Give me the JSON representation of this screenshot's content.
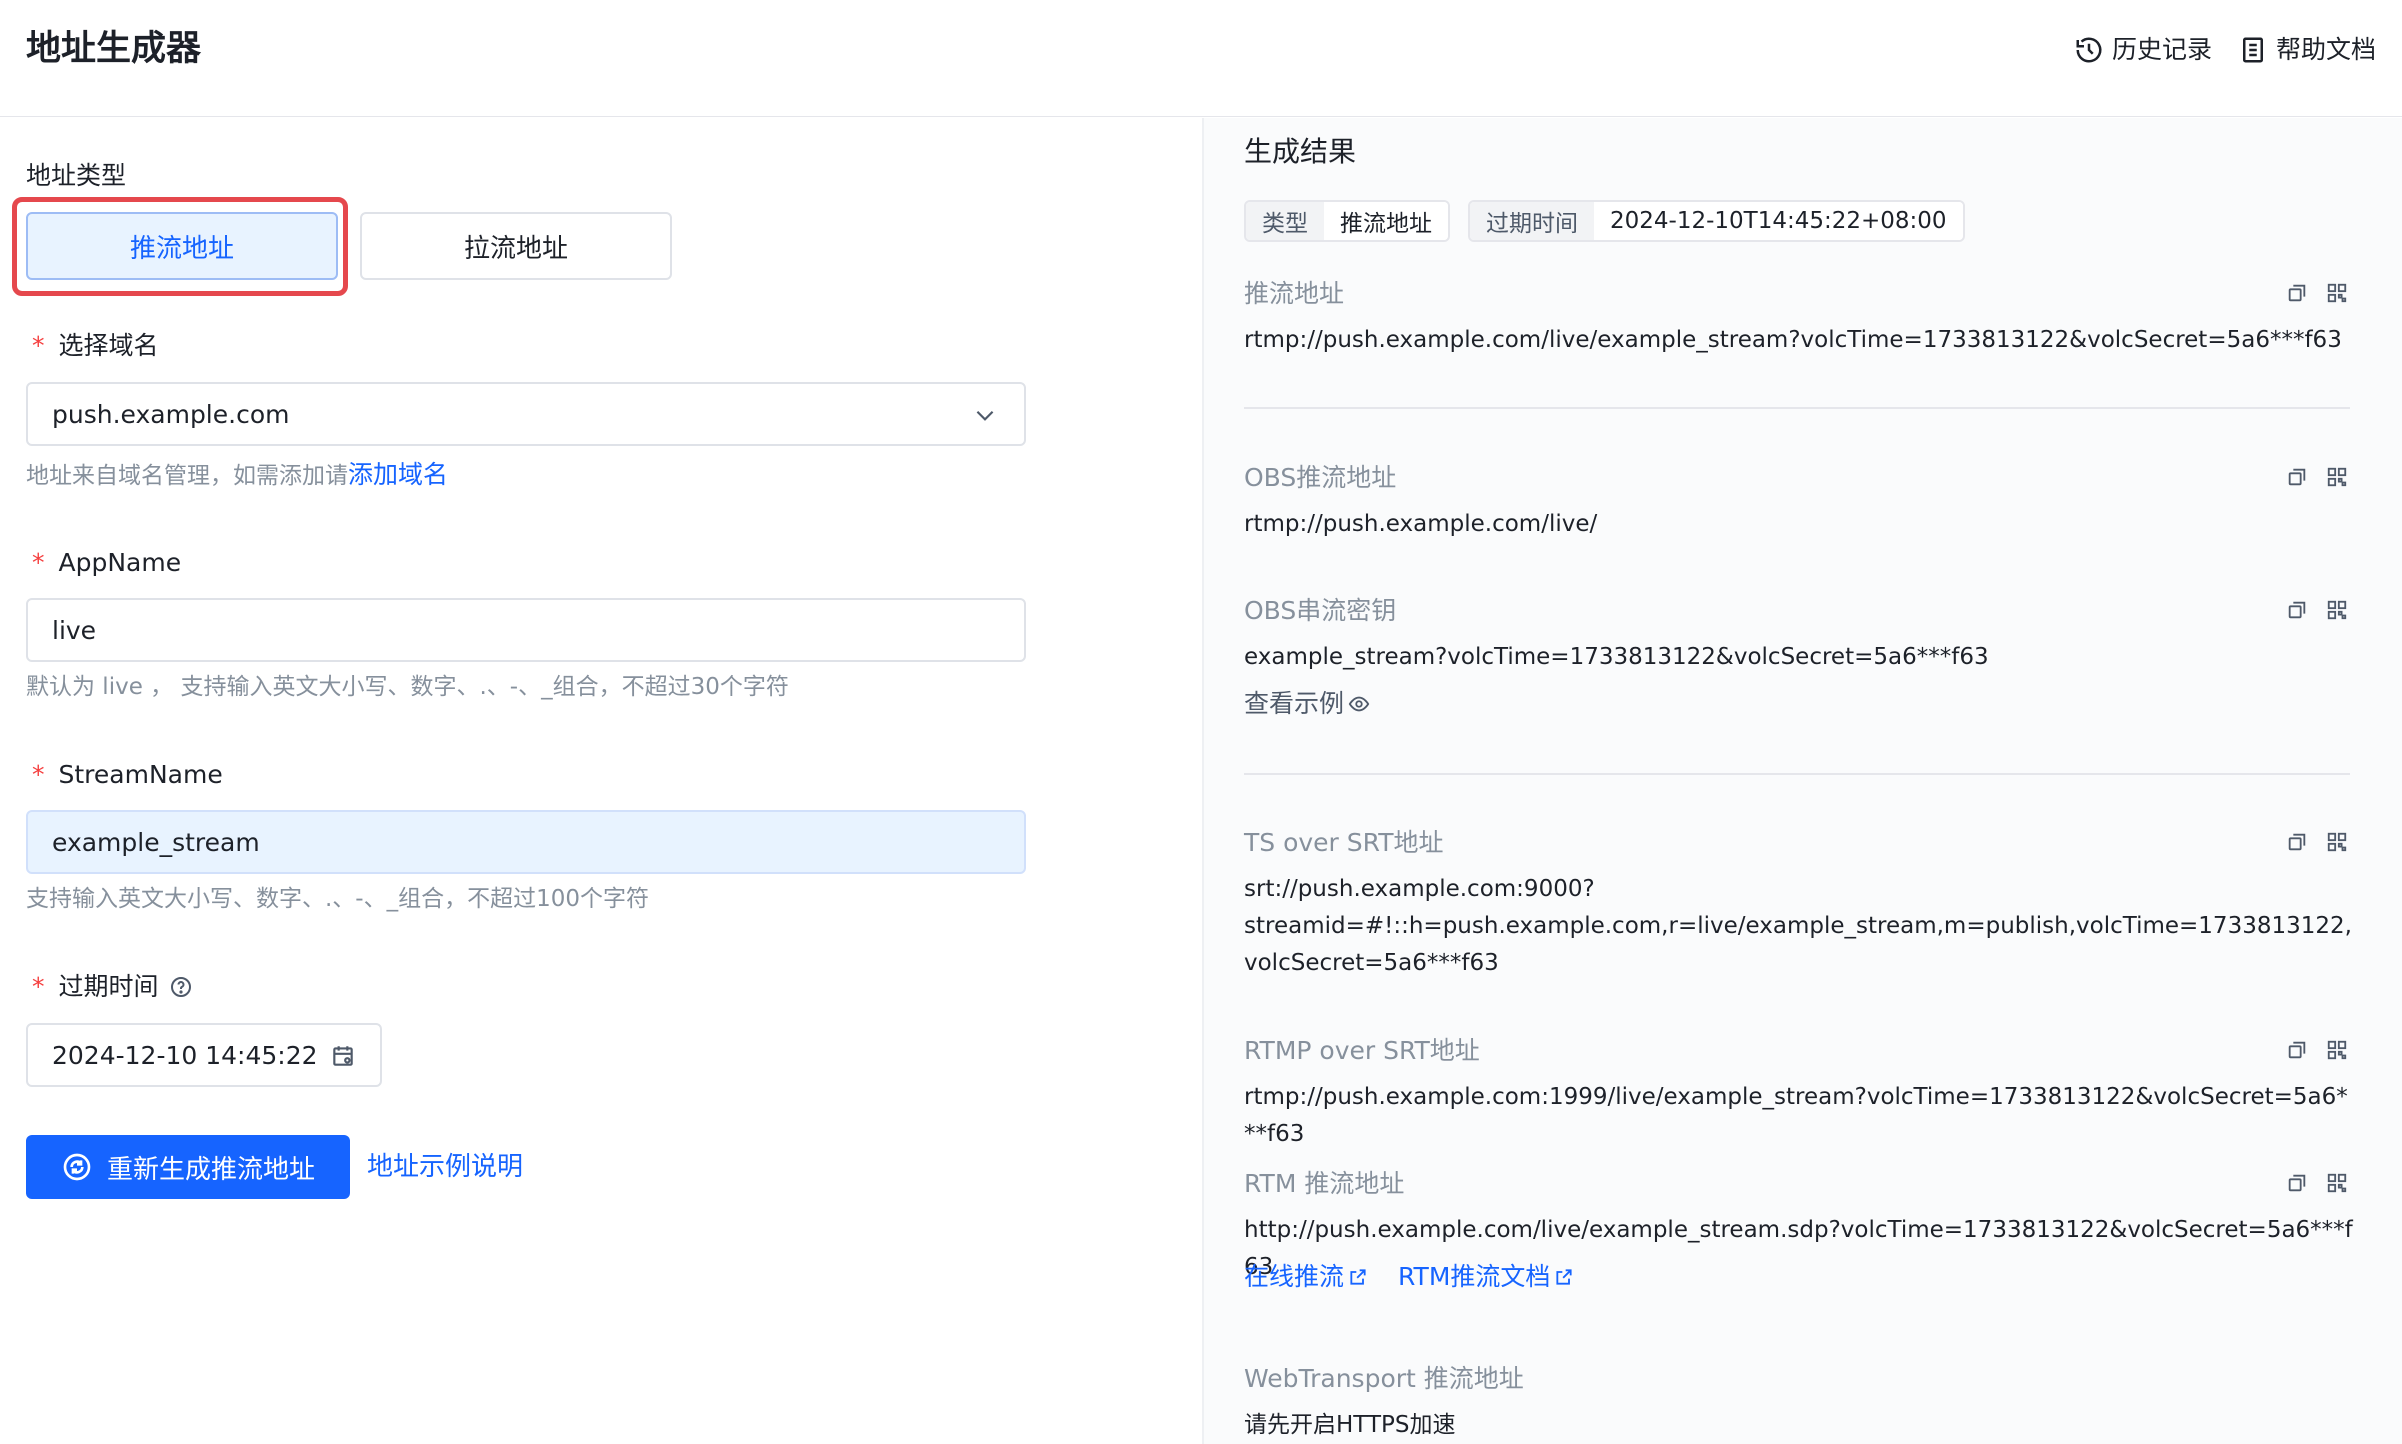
{
  "header": {
    "title": "地址生成器",
    "history_label": "历史记录",
    "help_label": "帮助文档"
  },
  "form": {
    "address_type_label": "地址类型",
    "type_options": [
      "推流地址",
      "拉流地址"
    ],
    "selected_type": "推流地址",
    "domain": {
      "label": "选择域名",
      "value": "push.example.com",
      "hint_prefix": "地址来自域名管理，如需添加请",
      "hint_link": "添加域名"
    },
    "appname": {
      "label": "AppName",
      "value": "live",
      "hint": "默认为 live ， 支持输入英文大小写、数字、.、-、_组合，不超过30个字符"
    },
    "streamname": {
      "label": "StreamName",
      "value": "example_stream",
      "hint": "支持输入英文大小写、数字、.、-、_组合，不超过100个字符"
    },
    "expire": {
      "label": "过期时间",
      "value": "2024-12-10 14:45:22"
    },
    "regenerate_label": "重新生成推流地址",
    "example_link": "地址示例说明"
  },
  "result": {
    "title": "生成结果",
    "tags": [
      {
        "key": "类型",
        "value": "推流地址"
      },
      {
        "key": "过期时间",
        "value": "2024-12-10T14:45:22+08:00"
      }
    ],
    "items": {
      "push": {
        "label": "推流地址",
        "value": "rtmp://push.example.com/live/example_stream?volcTime=1733813122&volcSecret=5a6***f63"
      },
      "obs_push": {
        "label": "OBS推流地址",
        "value": "rtmp://push.example.com/live/"
      },
      "obs_key": {
        "label": "OBS串流密钥",
        "value": "example_stream?volcTime=1733813122&volcSecret=5a6***f63",
        "example_link": "查看示例"
      },
      "ts_srt": {
        "label": "TS over SRT地址",
        "value_line1": "srt://push.example.com:9000?",
        "value_line2": "streamid=#!::h=push.example.com,r=live/example_stream,m=publish,volcTime=1733813122,volcSecret=5a6***f63"
      },
      "rtmp_srt": {
        "label": "RTMP over SRT地址",
        "value": "rtmp://push.example.com:1999/live/example_stream?volcTime=1733813122&volcSecret=5a6***f63"
      },
      "rtm": {
        "label": "RTM 推流地址",
        "value": "http://push.example.com/live/example_stream.sdp?volcTime=1733813122&volcSecret=5a6***f63",
        "link1": "在线推流",
        "link2": "RTM推流文档"
      },
      "webtransport": {
        "label": "WebTransport 推流地址",
        "value": "请先开启HTTPS加速"
      }
    }
  },
  "colors": {
    "accent": "#1664ff",
    "required": "#f53f3f",
    "highlight_outline": "#e5484d"
  }
}
